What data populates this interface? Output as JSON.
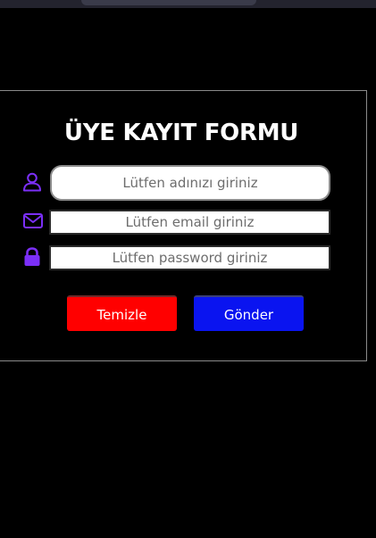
{
  "form": {
    "title": "ÜYE KAYIT FORMU",
    "fields": {
      "name": {
        "placeholder": "Lütfen adınızı giriniz",
        "icon": "user-icon"
      },
      "email": {
        "placeholder": "Lütfen email giriniz",
        "icon": "envelope-icon"
      },
      "password": {
        "placeholder": "Lütfen password giriniz",
        "icon": "lock-icon"
      }
    },
    "buttons": {
      "clear_label": "Temizle",
      "send_label": "Gönder"
    }
  },
  "colors": {
    "icon_purple": "#7b2ff7",
    "clear_button": "#ff0000",
    "send_button": "#0a14f0"
  }
}
